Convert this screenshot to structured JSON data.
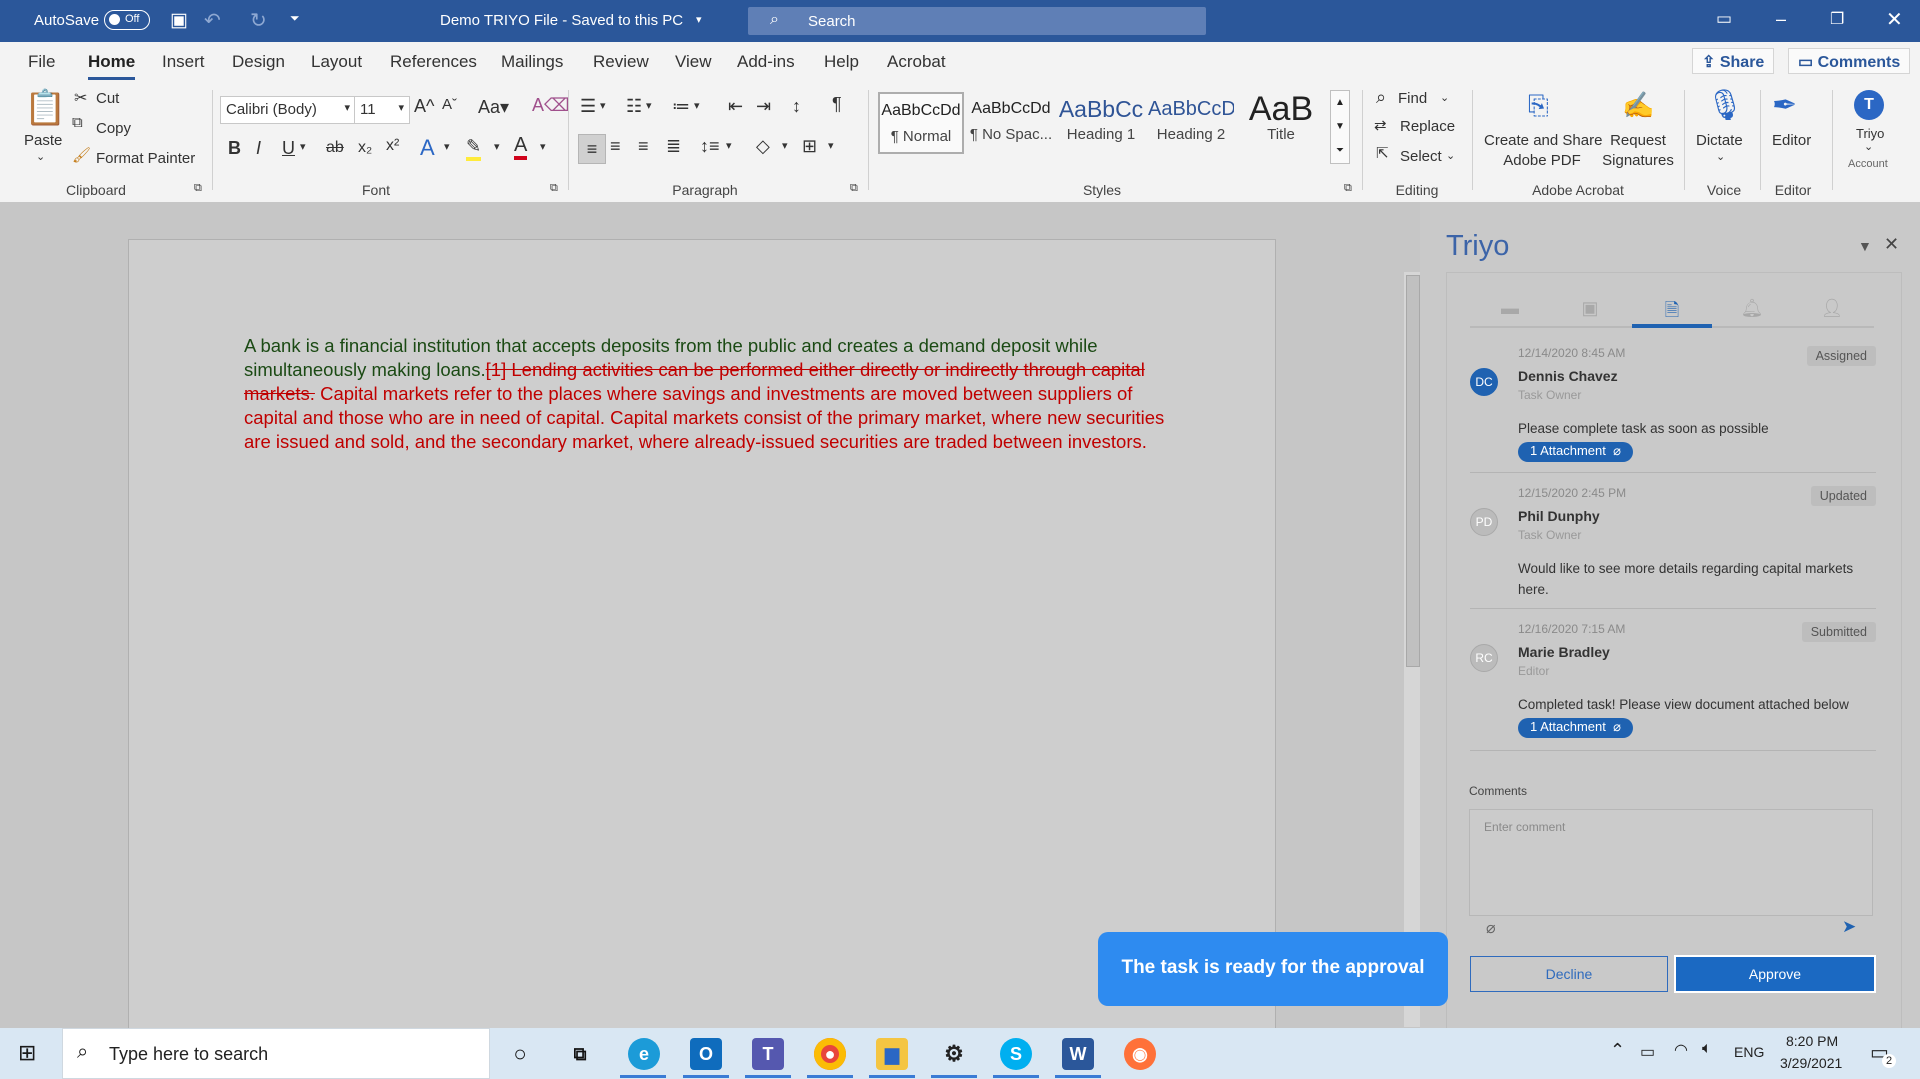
{
  "titlebar": {
    "autosave_label": "AutoSave",
    "autosave_state": "Off",
    "doc_title": "Demo TRIYO File  -  Saved to this PC",
    "search_placeholder": "Search"
  },
  "tabs": [
    "File",
    "Home",
    "Insert",
    "Design",
    "Layout",
    "References",
    "Mailings",
    "Review",
    "View",
    "Add-ins",
    "Help",
    "Acrobat"
  ],
  "active_tab": "Home",
  "share_label": "Share",
  "comments_label": "Comments",
  "ribbon": {
    "clipboard": {
      "paste": "Paste",
      "cut": "Cut",
      "copy": "Copy",
      "format_painter": "Format Painter",
      "group": "Clipboard"
    },
    "font": {
      "name": "Calibri (Body)",
      "size": "11",
      "group": "Font"
    },
    "paragraph": {
      "group": "Paragraph"
    },
    "styles": {
      "items": [
        {
          "preview": "AaBbCcDd",
          "name": "¶ Normal"
        },
        {
          "preview": "AaBbCcDd",
          "name": "¶ No Spac..."
        },
        {
          "preview": "AaBbCc",
          "name": "Heading 1"
        },
        {
          "preview": "AaBbCcD",
          "name": "Heading 2"
        },
        {
          "preview": "AaB",
          "name": "Title"
        }
      ],
      "group": "Styles"
    },
    "editing": {
      "find": "Find",
      "replace": "Replace",
      "select": "Select",
      "group": "Editing"
    },
    "acrobat": {
      "create": "Create and Share",
      "create2": "Adobe PDF",
      "request": "Request",
      "request2": "Signatures",
      "group": "Adobe Acrobat"
    },
    "voice": {
      "dictate": "Dictate",
      "group": "Voice"
    },
    "editor": {
      "label": "Editor",
      "group": "Editor"
    },
    "triyo": {
      "label": "Triyo",
      "sub": "Account",
      "initial": "T"
    }
  },
  "document": {
    "green_text": "A bank is a financial institution that accepts deposits from the public and creates a demand deposit while simultaneously making loans.",
    "deleted_text": "[1] Lending activities can be performed either directly or indirectly through capital markets.",
    "red_text": " Capital markets refer to the places where savings and investments are moved between suppliers of capital and those who are in need of capital. Capital markets consist of the primary market, where new securities are issued and sold, and the secondary market, where already-issued securities are traded between investors."
  },
  "pane": {
    "title": "Triyo",
    "comments": [
      {
        "date": "12/14/2020  8:45 AM",
        "status": "Assigned",
        "initials": "DC",
        "name": "Dennis Chavez",
        "role": "Task Owner",
        "message": "Please complete task as soon as possible",
        "attachment": "1 Attachment"
      },
      {
        "date": "12/15/2020  2:45 PM",
        "status": "Updated",
        "initials": "PD",
        "name": "Phil Dunphy",
        "role": "Task Owner",
        "message": "Would like to see more details regarding capital markets here.",
        "attachment": ""
      },
      {
        "date": "12/16/2020  7:15 AM",
        "status": "Submitted",
        "initials": "RC",
        "name": "Marie Bradley",
        "role": "Editor",
        "message": "Completed task! Please view document attached below",
        "attachment": "1 Attachment"
      }
    ],
    "comments_label": "Comments",
    "comment_placeholder": "Enter comment",
    "decline": "Decline",
    "approve": "Approve"
  },
  "toast": "The task is ready for the approval",
  "taskbar": {
    "search_placeholder": "Type here to search",
    "lang": "ENG",
    "time": "8:20 PM",
    "date": "3/29/2021",
    "notifications": "2"
  }
}
